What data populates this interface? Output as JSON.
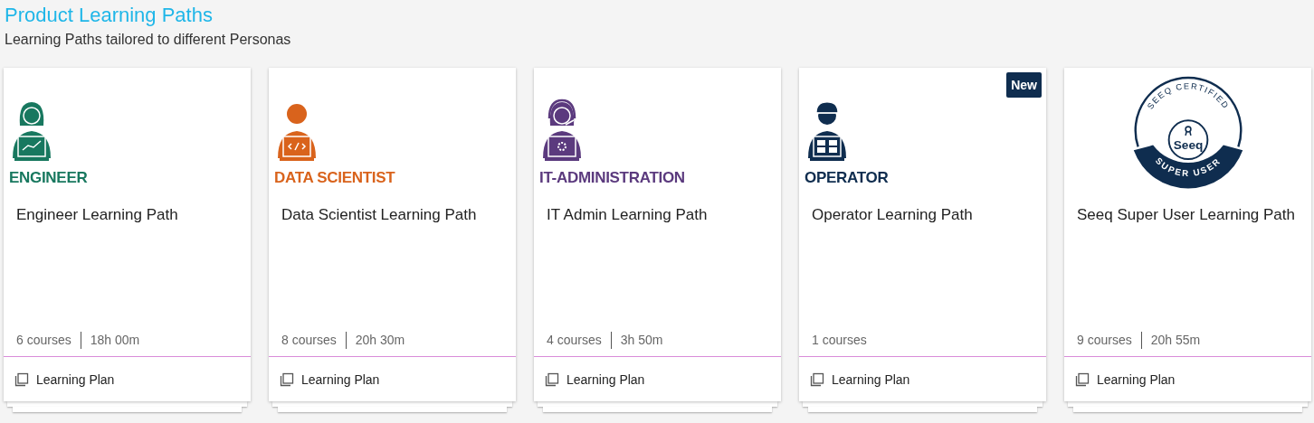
{
  "header": {
    "title": "Product Learning Paths",
    "subtitle": "Learning Paths tailored to different Personas"
  },
  "cards": [
    {
      "kind": "engineer",
      "persona_label": "ENGINEER",
      "color": "#18785f",
      "title": "Engineer Learning Path",
      "courses": "6 courses",
      "duration": "18h 00m",
      "type": "Learning Plan"
    },
    {
      "kind": "data_scientist",
      "persona_label": "DATA SCIENTIST",
      "color": "#d9631c",
      "title": "Data Scientist Learning Path",
      "courses": "8 courses",
      "duration": "20h 30m",
      "type": "Learning Plan"
    },
    {
      "kind": "it_admin",
      "persona_label": "IT-ADMINISTRATION",
      "color": "#5b3a7e",
      "title": "IT Admin Learning Path",
      "courses": "4 courses",
      "duration": "3h 50m",
      "type": "Learning Plan"
    },
    {
      "kind": "operator",
      "persona_label": "OPERATOR",
      "color": "#0f2d4f",
      "title": "Operator Learning Path",
      "courses": "1 courses",
      "tag": "New",
      "type": "Learning Plan"
    },
    {
      "kind": "badge",
      "badge": {
        "arc": "SEEQ CERTIFIED",
        "logo": "Seeq",
        "band": "SUPER USER"
      },
      "color": "#0f2d4f",
      "title": "Seeq Super User Learning Path",
      "courses": "9 courses",
      "duration": "20h 55m",
      "type": "Learning Plan"
    }
  ]
}
